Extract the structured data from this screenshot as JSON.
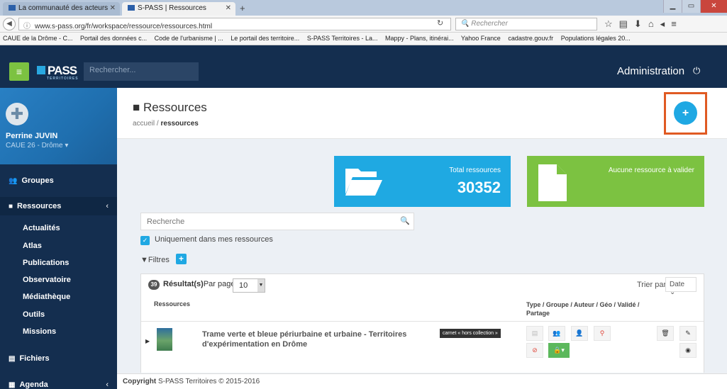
{
  "browser": {
    "tabs": [
      {
        "label": "La communauté des acteurs"
      },
      {
        "label": "S-PASS | Ressources"
      }
    ],
    "url": "www.s-pass.org/fr/workspace/ressource/ressources.html",
    "search_placeholder": "Rechercher",
    "bookmarks": [
      "CAUE de la Drôme - C...",
      "Portail des données c...",
      "Code de l'urbanisme | ...",
      "Le portail des territoire...",
      "S-PASS Territoires - La...",
      "Mappy - Plans, itinérai...",
      "Yahoo France",
      "cadastre.gouv.fr",
      "Populations légales 20..."
    ]
  },
  "header": {
    "logo": "PASS",
    "logo_sub": "TERRITOIRES",
    "search_placeholder": "Rechercher...",
    "admin_label": "Administration"
  },
  "user": {
    "name": "Perrine JUVIN",
    "org": "CAUE 26 - Drôme"
  },
  "sidebar": {
    "groupes": "Groupes",
    "ressources": "Ressources",
    "sub": [
      "Actualités",
      "Atlas",
      "Publications",
      "Observatoire",
      "Médiathèque",
      "Outils",
      "Missions"
    ],
    "fichiers": "Fichiers",
    "agenda": "Agenda"
  },
  "page": {
    "title": "Ressources",
    "breadcrumb_home": "accueil",
    "breadcrumb_current": "ressources"
  },
  "cards": {
    "total_label": "Total ressources",
    "total_value": "30352",
    "pending_label": "Aucune ressource à valider"
  },
  "filters": {
    "search_placeholder": "Recherche",
    "only_mine": "Uniquement dans mes ressources",
    "filtres": "Filtres"
  },
  "results": {
    "count": "39",
    "label": "Résultat(s)",
    "per_page_label": "Par page",
    "per_page_value": "10",
    "sort_label": "Trier par",
    "sort_value": "Date",
    "col_resources": "Ressources",
    "col_meta": "Type / Groupe / Auteur / Géo / Validé / Partage",
    "rows": [
      {
        "title": "Trame verte et bleue périurbaine et urbaine - Territoires d'expérimentation en Drôme",
        "tag": "carnet « hors collection »"
      }
    ]
  },
  "footer": {
    "copyright": "Copyright",
    "text": "S-PASS Territoires © 2015-2016"
  },
  "colors": {
    "navy": "#142e4f",
    "green": "#7cc241",
    "blue": "#1fa9e2",
    "highlight": "#e05a23"
  }
}
